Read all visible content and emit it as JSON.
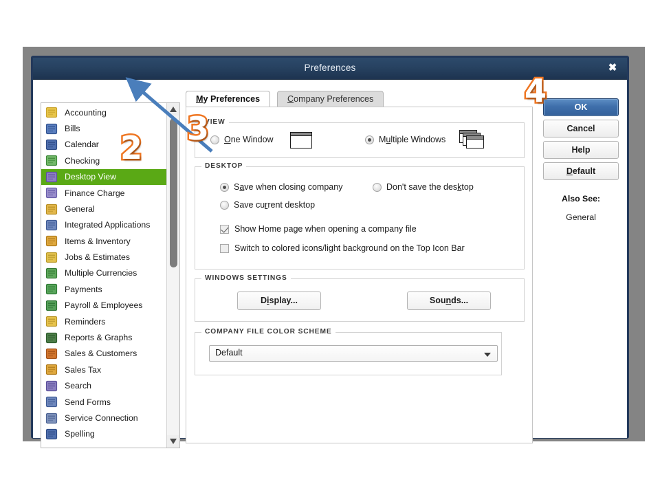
{
  "window": {
    "title": "Preferences",
    "close_label": "✖"
  },
  "sidebar": {
    "items": [
      {
        "label": "Accounting",
        "icon": "ledger-icon",
        "selected": false
      },
      {
        "label": "Bills",
        "icon": "bill-icon",
        "selected": false
      },
      {
        "label": "Calendar",
        "icon": "calendar-icon",
        "selected": false
      },
      {
        "label": "Checking",
        "icon": "check-icon",
        "selected": false
      },
      {
        "label": "Desktop View",
        "icon": "desktop-icon",
        "selected": true
      },
      {
        "label": "Finance Charge",
        "icon": "percent-icon",
        "selected": false
      },
      {
        "label": "General",
        "icon": "folder-icon",
        "selected": false
      },
      {
        "label": "Integrated Applications",
        "icon": "apps-icon",
        "selected": false
      },
      {
        "label": "Items & Inventory",
        "icon": "box-icon",
        "selected": false
      },
      {
        "label": "Jobs & Estimates",
        "icon": "notepad-icon",
        "selected": false
      },
      {
        "label": "Multiple Currencies",
        "icon": "currency-icon",
        "selected": false
      },
      {
        "label": "Payments",
        "icon": "payment-icon",
        "selected": false
      },
      {
        "label": "Payroll & Employees",
        "icon": "payroll-icon",
        "selected": false
      },
      {
        "label": "Reminders",
        "icon": "clock-icon",
        "selected": false
      },
      {
        "label": "Reports & Graphs",
        "icon": "bar-chart-icon",
        "selected": false
      },
      {
        "label": "Sales & Customers",
        "icon": "sales-icon",
        "selected": false
      },
      {
        "label": "Sales Tax",
        "icon": "tax-icon",
        "selected": false
      },
      {
        "label": "Search",
        "icon": "magnifier-icon",
        "selected": false
      },
      {
        "label": "Send Forms",
        "icon": "envelope-icon",
        "selected": false
      },
      {
        "label": "Service Connection",
        "icon": "connection-icon",
        "selected": false
      },
      {
        "label": "Spelling",
        "icon": "spellcheck-icon",
        "selected": false
      }
    ]
  },
  "tabs": {
    "my_preferences": "My Preferences",
    "company_preferences": "Company Preferences",
    "active": "My Preferences"
  },
  "view_group": {
    "legend": "VIEW",
    "one_window": {
      "label": "One Window",
      "selected": false
    },
    "multiple_windows": {
      "label": "Multiple Windows",
      "selected": true
    }
  },
  "desktop_group": {
    "legend": "DESKTOP",
    "save_when_closing": {
      "label": "Save when closing company",
      "selected": true
    },
    "dont_save": {
      "label": "Don't save the desktop",
      "selected": false
    },
    "save_current": {
      "label": "Save current desktop",
      "selected": false
    },
    "show_home_page": {
      "label": "Show Home page when opening a company file",
      "checked": true
    },
    "colored_icons": {
      "label": "Switch to colored icons/light background on the Top Icon Bar",
      "checked": false
    }
  },
  "windows_settings": {
    "legend": "WINDOWS SETTINGS",
    "display_button": "Display...",
    "sounds_button": "Sounds..."
  },
  "color_scheme": {
    "legend": "COMPANY FILE COLOR SCHEME",
    "selected": "Default"
  },
  "actions": {
    "ok": "OK",
    "cancel": "Cancel",
    "help": "Help",
    "default": "Default",
    "also_see_label": "Also See:",
    "also_see_link": "General"
  },
  "annotations": {
    "step2": "2",
    "step3": "3",
    "step4": "4"
  },
  "colors": {
    "titlebar": "#274261",
    "selection_green": "#5aa915",
    "primary_button_blue": "#3f6fab",
    "annotation_orange": "#ef7622",
    "arrow_blue": "#4a7ebb",
    "backdrop_gray": "#848484"
  }
}
